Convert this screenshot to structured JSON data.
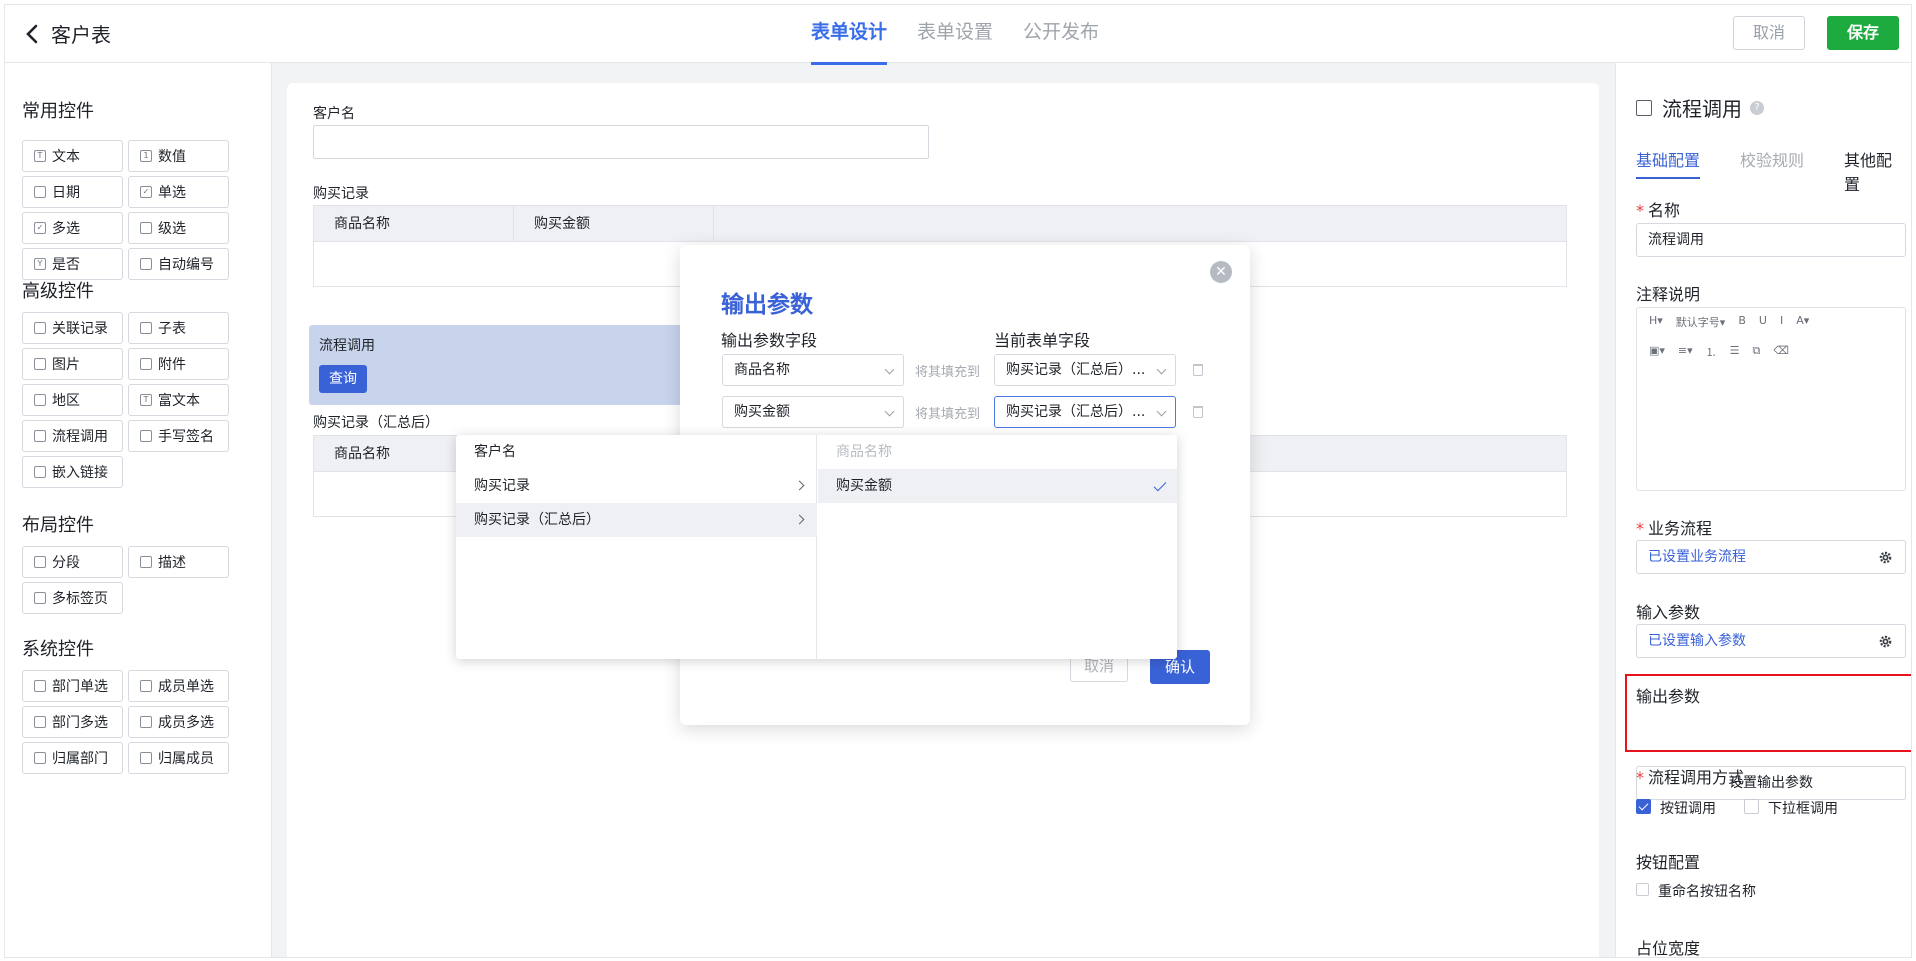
{
  "header": {
    "back_title": "客户表",
    "tabs": [
      "表单设计",
      "表单设置",
      "公开发布"
    ],
    "cancel_label": "取消",
    "save_label": "保存"
  },
  "left_panel": {
    "groups": [
      {
        "title": "常用控件",
        "items": [
          "文本",
          "数值",
          "日期",
          "单选",
          "多选",
          "级选",
          "是否",
          "自动编号"
        ]
      },
      {
        "title": "高级控件",
        "items": [
          "关联记录",
          "子表",
          "图片",
          "附件",
          "地区",
          "富文本",
          "流程调用",
          "手写签名",
          "嵌入链接"
        ]
      },
      {
        "title": "布局控件",
        "items": [
          "分段",
          "描述",
          "多标签页"
        ]
      },
      {
        "title": "系统控件",
        "items": [
          "部门单选",
          "成员单选",
          "部门多选",
          "成员多选",
          "归属部门",
          "归属成员"
        ]
      }
    ]
  },
  "canvas": {
    "field_customer": "客户名",
    "field_purchase": "购买记录",
    "purchase_cols": [
      "商品名称",
      "购买金额"
    ],
    "flow_label": "流程调用",
    "query_button": "查询",
    "field_purchase_summary": "购买记录（汇总后）",
    "summary_cols": [
      "商品名称"
    ]
  },
  "modal": {
    "title": "输出参数",
    "col_output": "输出参数字段",
    "col_current": "当前表单字段",
    "rows": [
      {
        "output": "商品名称",
        "fill": "将其填充到",
        "current": "购买记录（汇总后）..."
      },
      {
        "output": "购买金额",
        "fill": "将其填充到",
        "current": "购买记录（汇总后）..."
      }
    ],
    "cancel": "取消",
    "confirm": "确认"
  },
  "cascader": {
    "col1": [
      {
        "label": "客户名",
        "has_children": false,
        "active": false
      },
      {
        "label": "购买记录",
        "has_children": true,
        "active": false
      },
      {
        "label": "购买记录（汇总后）",
        "has_children": true,
        "active": true
      }
    ],
    "col2": [
      {
        "label": "商品名称",
        "disabled": true,
        "selected": false
      },
      {
        "label": "购买金额",
        "disabled": false,
        "selected": true
      }
    ]
  },
  "right_panel": {
    "title": "流程调用",
    "tabs": [
      "基础配置",
      "校验规则",
      "其他配置"
    ],
    "name_label": "名称",
    "name_value": "流程调用",
    "note_label": "注释说明",
    "editor_toolbar_row1": [
      "H▾",
      "默认字号▾",
      "B",
      "U",
      "I",
      "A▾"
    ],
    "editor_toolbar_row2": [
      "▣▾",
      "≡▾",
      "⒈",
      "☰",
      "⧉",
      "⌫"
    ],
    "business_flow_label": "业务流程",
    "business_flow_value": "已设置业务流程",
    "input_params_label": "输入参数",
    "input_params_value": "已设置输入参数",
    "output_params_label": "输出参数",
    "output_params_button": "设置输出参数",
    "call_mode_label": "流程调用方式",
    "call_mode_button": "按钮调用",
    "call_mode_dropdown": "下拉框调用",
    "button_config_label": "按钮配置",
    "rename_label": "重命名按钮名称",
    "width_label": "占位宽度"
  },
  "colors": {
    "accent": "#3a62d7",
    "save_green": "#1daa3f",
    "highlight_red": "#e8121c",
    "flow_block": "#c8d3ec"
  }
}
